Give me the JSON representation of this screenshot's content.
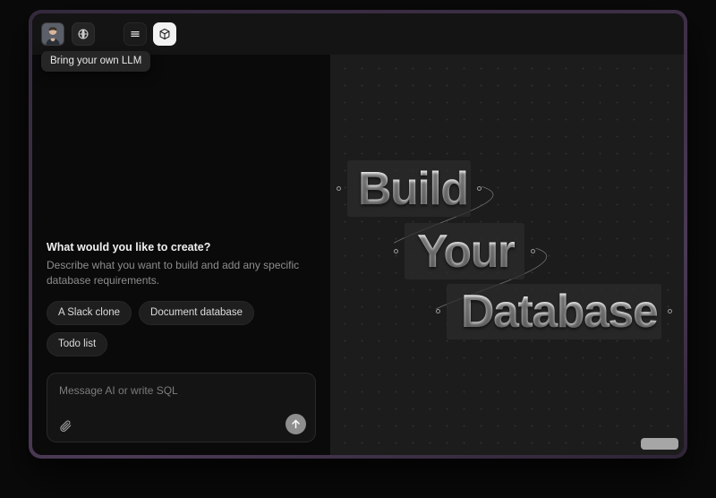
{
  "window": {
    "accent_border_color": "#4b3a55",
    "background_color": "#0b0b0b"
  },
  "header": {
    "avatar": {
      "name": "user-avatar",
      "alt": "User profile photo"
    },
    "byo_llm_button": {
      "icon": "globe-arrow-icon",
      "label": "Bring your own LLM"
    },
    "list_view_button": {
      "icon": "hamburger-menu-icon",
      "label": "List view"
    },
    "canvas_view_button": {
      "icon": "database-box-icon",
      "label": "Canvas view",
      "active": true,
      "active_color": "#f2f2f2"
    }
  },
  "tooltip": {
    "text": "Bring your own LLM"
  },
  "chat_panel": {
    "heading": "What would you like to create?",
    "subtext": "Describe what you want to build and add any specific database requirements.",
    "suggestions": [
      {
        "label": "A Slack clone"
      },
      {
        "label": "Document database"
      },
      {
        "label": "Todo list"
      }
    ],
    "composer": {
      "placeholder": "Message AI or write SQL",
      "value": "",
      "attach_icon": "paperclip-icon",
      "send_icon": "arrow-up-icon"
    }
  },
  "canvas": {
    "background_color": "#1c1c1c",
    "grid_dot_color": "#303030",
    "nodes": [
      {
        "id": "build",
        "label": "Build"
      },
      {
        "id": "your",
        "label": "Your"
      },
      {
        "id": "database",
        "label": "Database"
      }
    ],
    "scroll_indicator_color": "#a6a6a6"
  }
}
